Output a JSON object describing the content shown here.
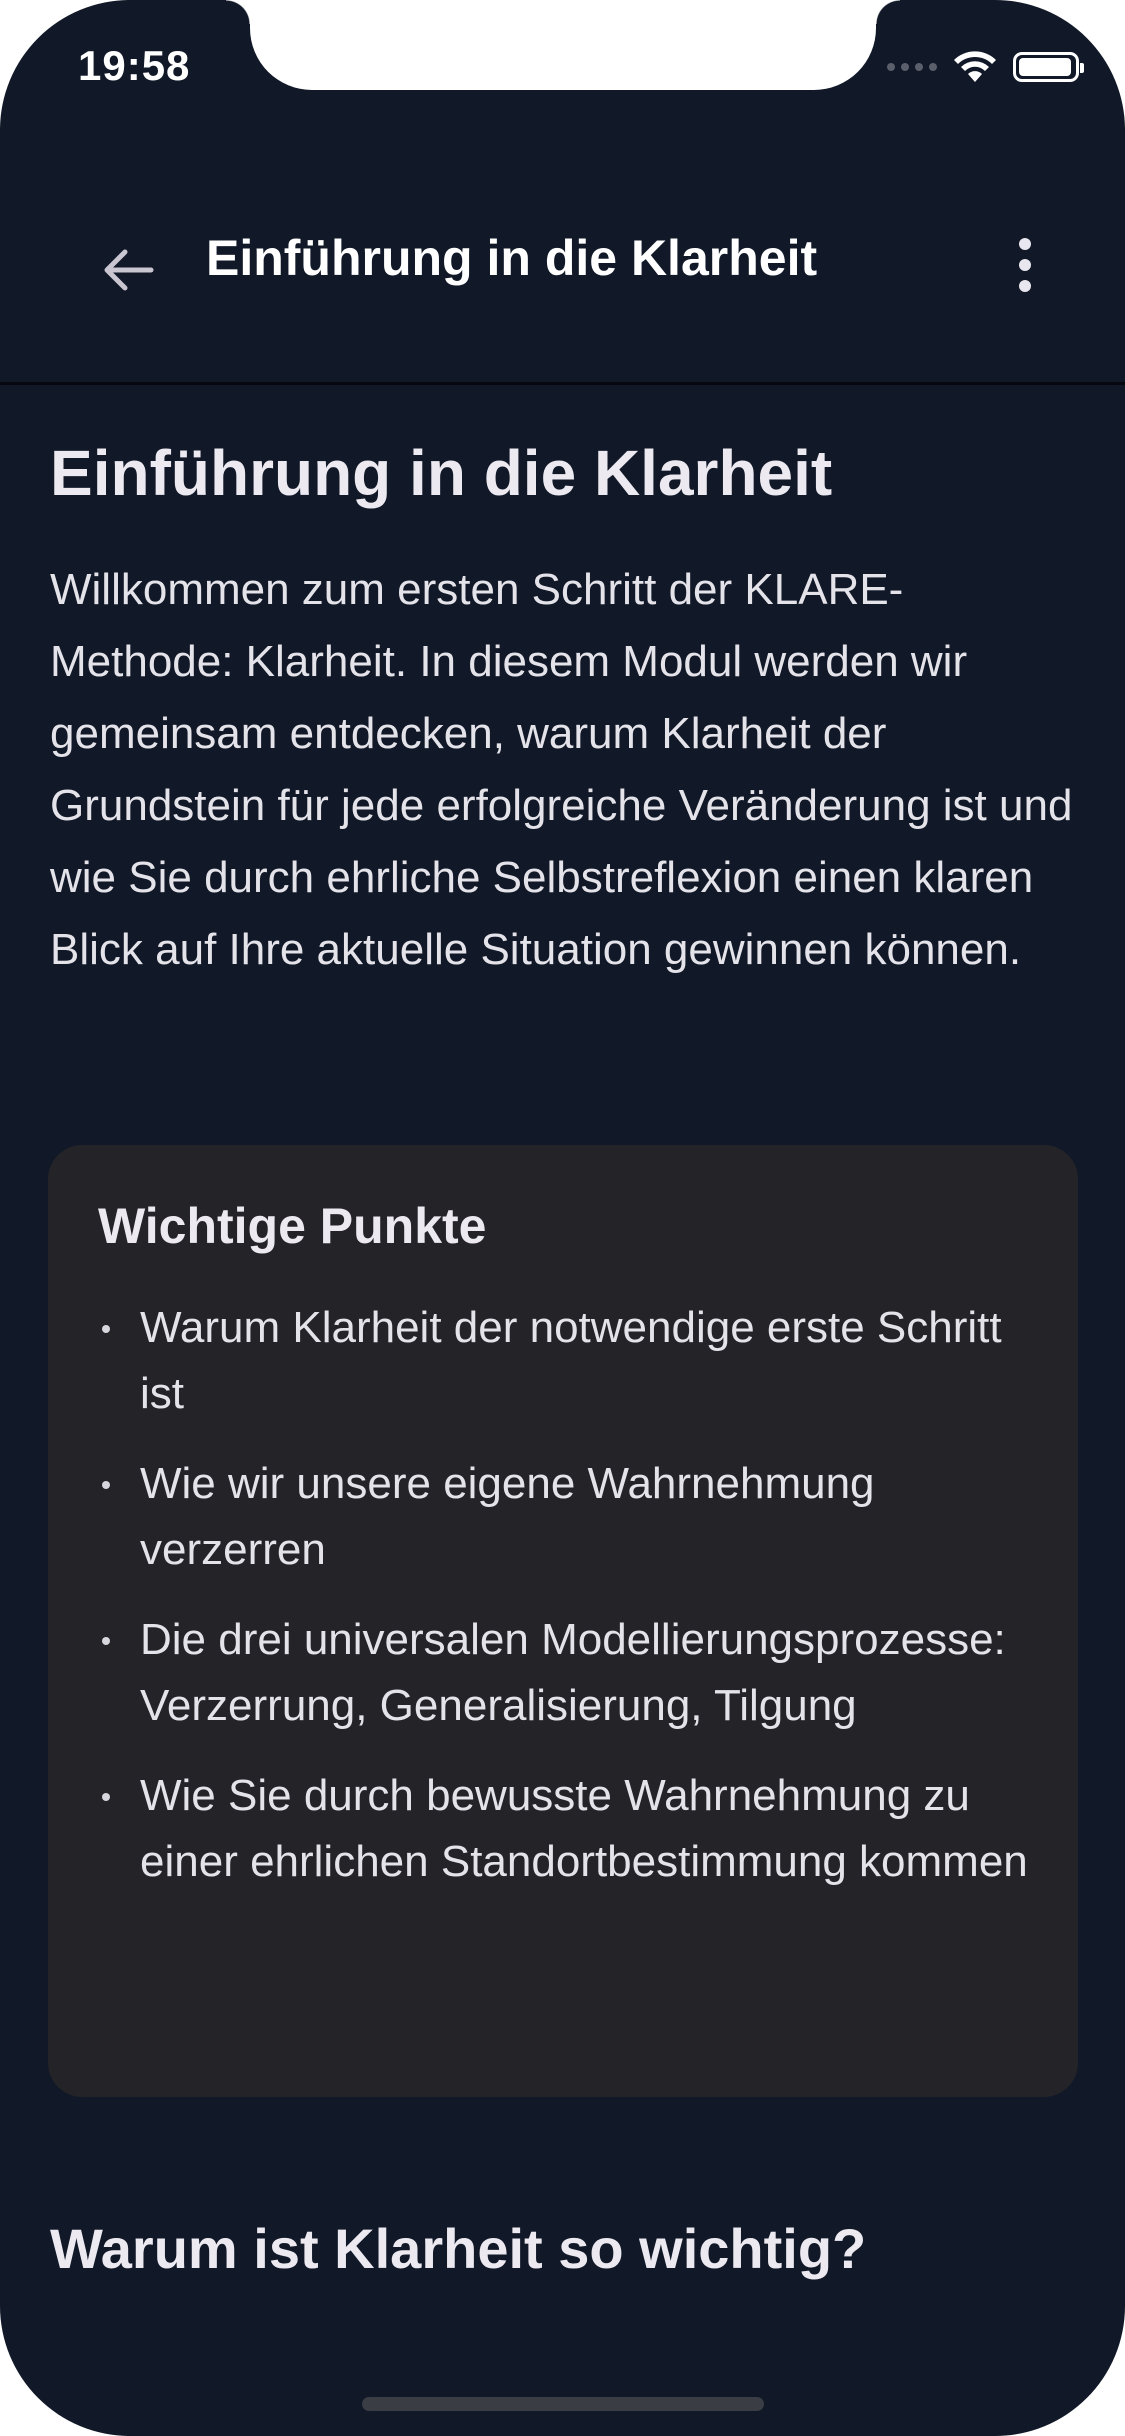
{
  "status_bar": {
    "time": "19:58",
    "icons": [
      "signal-dots-icon",
      "wifi-icon",
      "battery-icon"
    ]
  },
  "app_bar": {
    "back_icon": "arrow-left-icon",
    "title": "Einführung in die Klarheit",
    "more_icon": "more-vertical-icon"
  },
  "content": {
    "title": "Einführung in die Klarheit",
    "intro": "Willkommen zum ersten Schritt der KLARE-Methode: Klarheit. In diesem Modul werden wir gemeinsam entdecken, warum Klarheit der Grundstein für jede erfolgreiche Veränderung ist und wie Sie durch ehrliche Selbstreflexion einen klaren Blick auf Ihre aktuelle Situation gewinnen können.",
    "key_points": {
      "title": "Wichtige Punkte",
      "items": [
        "Warum Klarheit der notwendige erste Schritt ist",
        "Wie wir unsere eigene Wahrnehmung verzerren",
        "Die drei universalen Modellierungsprozesse: Verzerrung, Generalisierung, Tilgung",
        "Wie Sie durch bewusste Wahrnehmung zu einer ehrlichen Standortbestimmung kommen"
      ]
    },
    "section_title": "Warum ist Klarheit so wichtig?"
  },
  "colors": {
    "background": "#111827",
    "card": "#232328",
    "text": "#e8e6ee"
  }
}
